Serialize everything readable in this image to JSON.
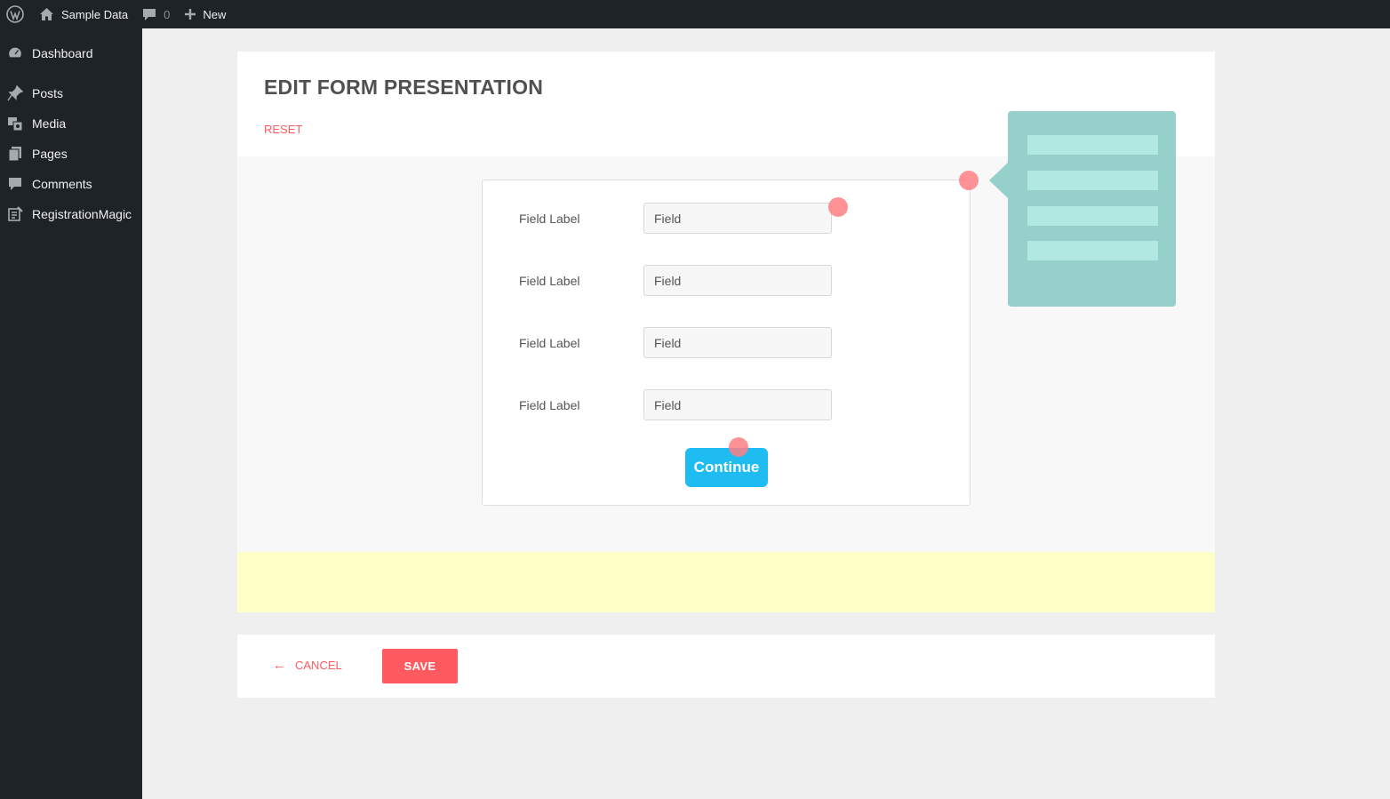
{
  "admin_bar": {
    "wp_logo_icon": "wordpress-logo-icon",
    "site_name": "Sample Data",
    "comments_count": "0",
    "new_label": "New"
  },
  "sidebar": {
    "items": [
      {
        "label": "Dashboard",
        "icon": "dashboard-icon"
      },
      {
        "label": "Posts",
        "icon": "pin-icon"
      },
      {
        "label": "Media",
        "icon": "media-icon"
      },
      {
        "label": "Pages",
        "icon": "pages-icon"
      },
      {
        "label": "Comments",
        "icon": "comment-icon"
      },
      {
        "label": "RegistrationMagic",
        "icon": "registrationmagic-icon"
      }
    ]
  },
  "main": {
    "title": "EDIT FORM PRESENTATION",
    "reset_label": "RESET",
    "form": {
      "rows": [
        {
          "label": "Field Label",
          "value": "Field"
        },
        {
          "label": "Field Label",
          "value": "Field"
        },
        {
          "label": "Field Label",
          "value": "Field"
        },
        {
          "label": "Field Label",
          "value": "Field"
        }
      ],
      "submit_label": "Continue"
    }
  },
  "footer": {
    "cancel_label": "CANCEL",
    "save_label": "SAVE"
  },
  "colors": {
    "admin_bg": "#1e2327",
    "accent_red": "#ff5a5f",
    "submit_blue": "#1fbcf2",
    "panel_teal": "#96d0cb",
    "panel_bar": "#b1e8e2",
    "hotspot": "#ff7f84",
    "strip_yellow": "#ffffc8"
  }
}
